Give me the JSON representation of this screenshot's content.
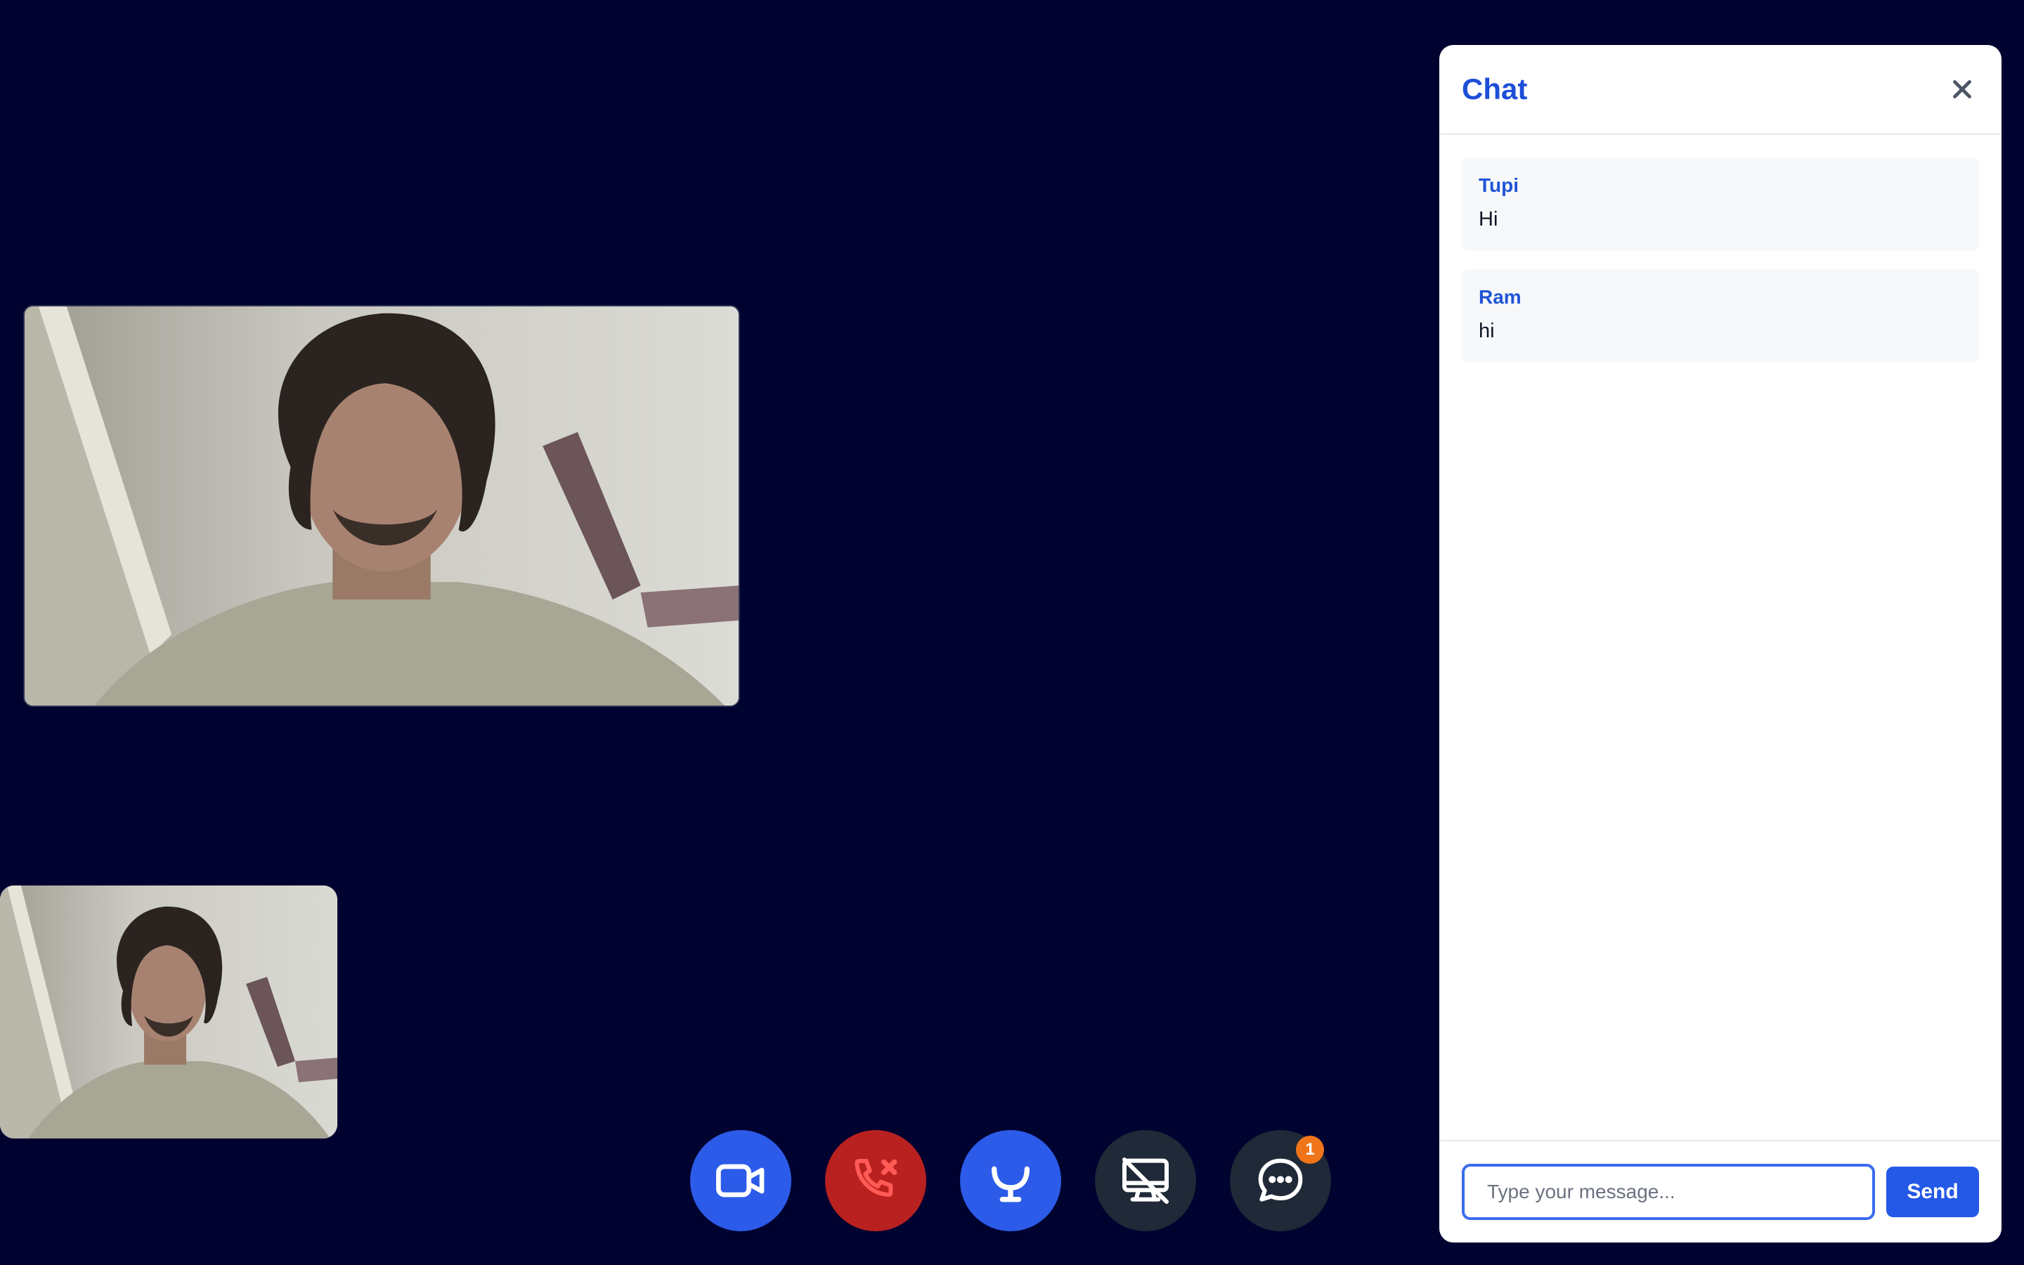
{
  "videos": {
    "remote": {
      "description": "remote-participant"
    },
    "local": {
      "description": "local-participant"
    }
  },
  "controls": {
    "video_icon": "video-camera-icon",
    "end_call_icon": "phone-x-icon",
    "mic_icon": "microphone-icon",
    "screen_share_icon": "monitor-off-icon",
    "chat_icon": "chat-bubble-icon",
    "chat_badge": "1"
  },
  "chat": {
    "title": "Chat",
    "messages": [
      {
        "sender": "Tupi",
        "text": "Hi"
      },
      {
        "sender": "Ram",
        "text": "hi"
      }
    ],
    "input_placeholder": "Type your message...",
    "input_value": "",
    "send_label": "Send"
  },
  "colors": {
    "background": "#000230",
    "primary": "#2b5be8",
    "danger": "#b8211f",
    "dark_button": "#1f2937",
    "badge": "#f0741a",
    "chat_title": "#1d4ed8"
  }
}
